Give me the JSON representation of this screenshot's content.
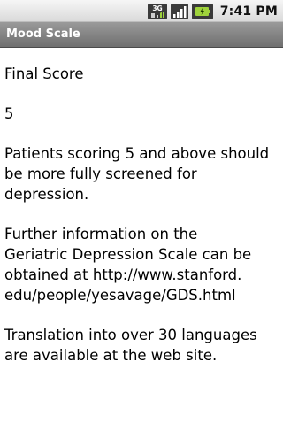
{
  "status_bar": {
    "network_badge": "3G",
    "time": "7:41",
    "time_suffix": "PM",
    "icons": [
      "network-3g-icon",
      "signal-bars-icon",
      "battery-icon"
    ]
  },
  "title_bar": {
    "title": "Mood Scale"
  },
  "content": {
    "heading": "Final Score",
    "score": "5",
    "paragraph1": "Patients scoring 5 and above should be more fully screened for depression.",
    "paragraph2_line1": "Further information on the",
    "paragraph2_line2": "Geriatric Depression Scale can be",
    "paragraph2_line3": "obtained at http://www.stanford.",
    "paragraph2_line4": "edu/people/yesavage/GDS.html",
    "paragraph3": "Translation into over 30 languages are available at the web site."
  }
}
